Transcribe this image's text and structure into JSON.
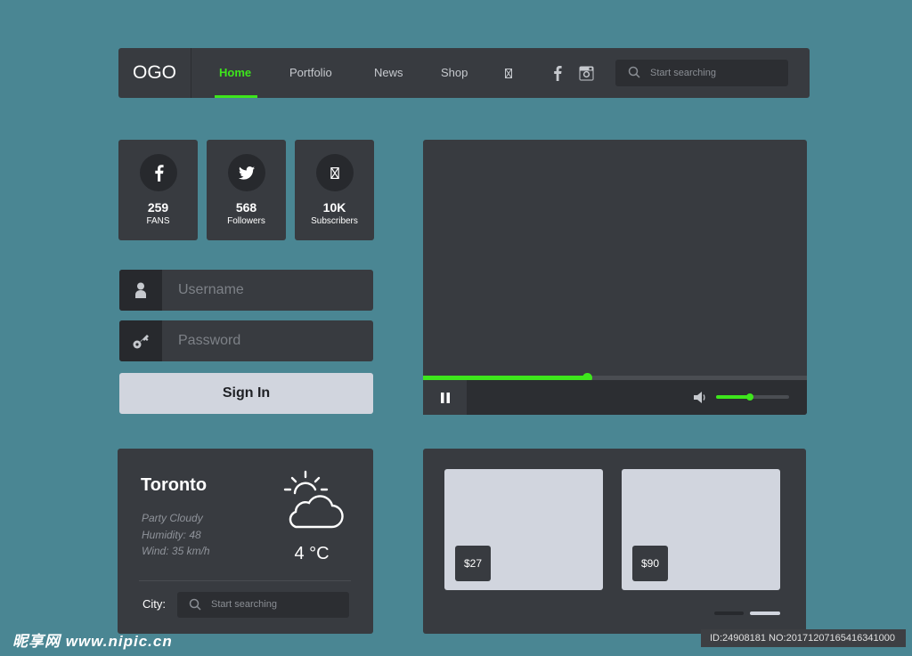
{
  "nav": {
    "logo": "OGO",
    "links": [
      "Home",
      "Portfolio",
      "News",
      "Shop"
    ],
    "active_link": "Home",
    "icons": [
      "unknown-glyph-icon",
      "facebook-icon",
      "instagram-icon"
    ],
    "search_placeholder": "Start searching"
  },
  "social": [
    {
      "icon": "facebook-icon",
      "count": "259",
      "label": "FANS"
    },
    {
      "icon": "twitter-icon",
      "count": "568",
      "label": "Followers"
    },
    {
      "icon": "unknown-glyph-icon",
      "count": "10K",
      "label": "Subscribers"
    }
  ],
  "login": {
    "username_placeholder": "Username",
    "password_placeholder": "Password",
    "signin_label": "Sign In"
  },
  "video": {
    "progress": 0.427,
    "volume": 0.46,
    "state": "playing"
  },
  "weather": {
    "city": "Toronto",
    "condition": "Party Cloudy",
    "humidity": "Humidity: 48",
    "wind": "Wind: 35 km/h",
    "temperature": "4 °C",
    "city_label": "City:",
    "search_placeholder": "Start searching"
  },
  "shop": {
    "items": [
      {
        "price": "$27"
      },
      {
        "price": "$90"
      }
    ],
    "active_page": 1,
    "page_count": 2
  },
  "watermark": {
    "left": "昵享网 www.nipic.cn",
    "right": "ID:24908181 NO:20171207165416341000"
  },
  "colors": {
    "background": "#4a8693",
    "panel": "#383b40",
    "accent": "#3ee61c",
    "button": "#d1d5de"
  }
}
